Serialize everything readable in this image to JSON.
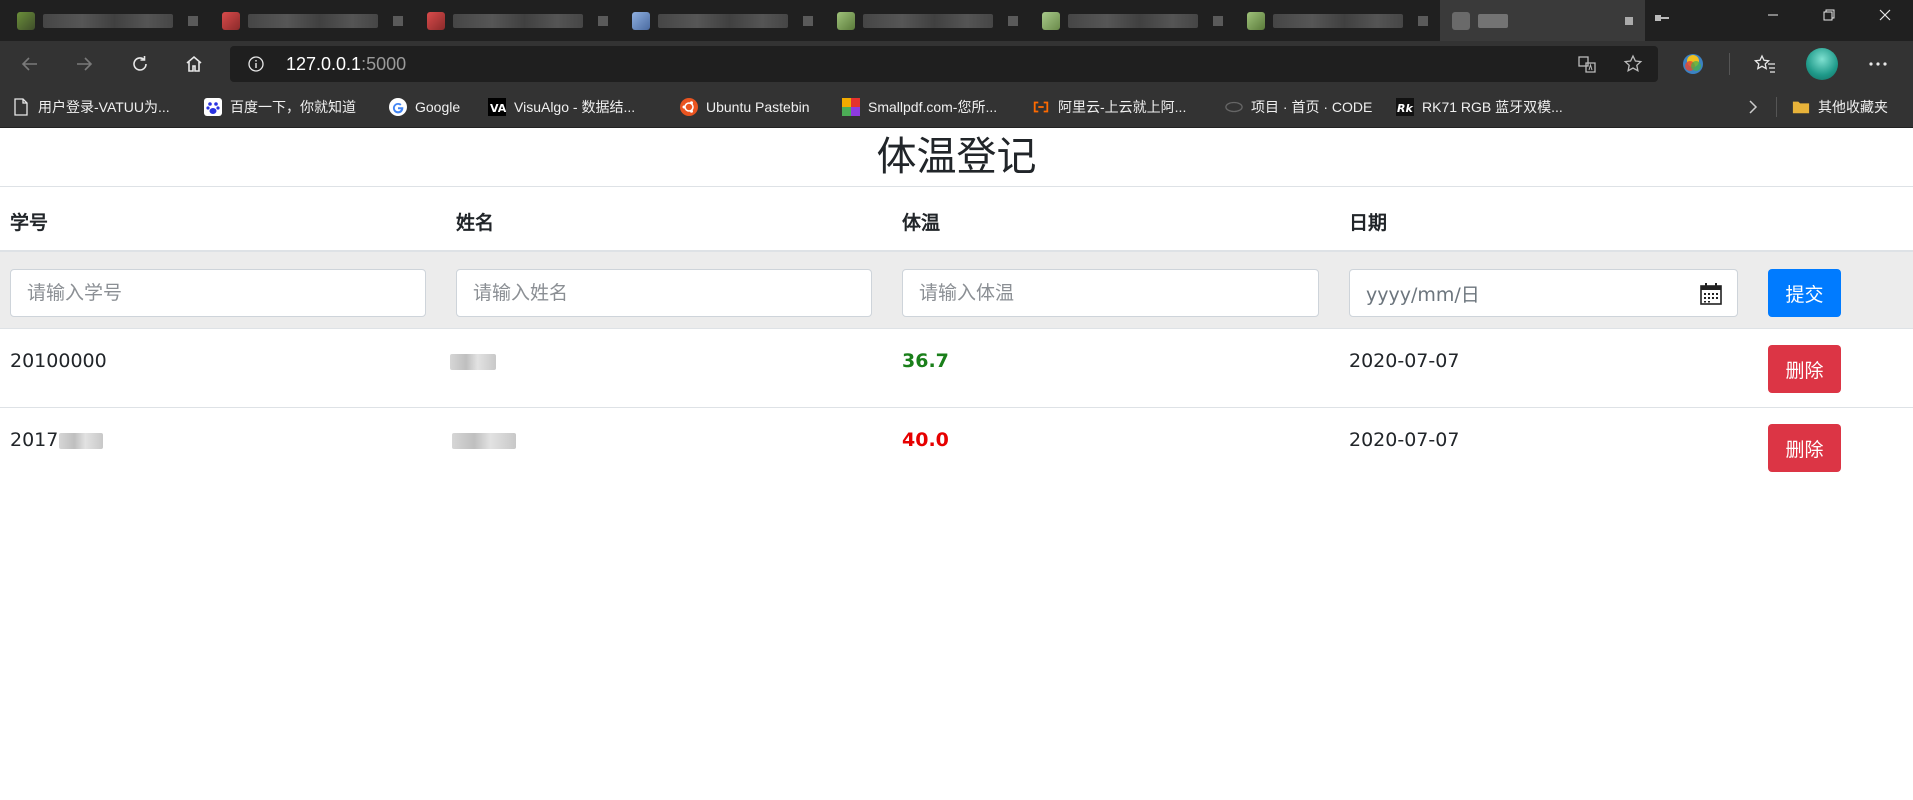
{
  "browser": {
    "url_host": "127.0.0.1",
    "url_port": ":5000",
    "bookmarks": [
      {
        "label": "用户登录-VATUU为...",
        "icon": "page-icon"
      },
      {
        "label": "百度一下，你就知道",
        "icon": "baidu-icon"
      },
      {
        "label": "Google",
        "icon": "google-icon"
      },
      {
        "label": "VisuAlgo - 数据结...",
        "icon": "visualgo-icon"
      },
      {
        "label": "Ubuntu Pastebin",
        "icon": "ubuntu-icon"
      },
      {
        "label": "Smallpdf.com-您所...",
        "icon": "smallpdf-icon"
      },
      {
        "label": "阿里云-上云就上阿...",
        "icon": "aliyun-icon"
      },
      {
        "label": "项目 · 首页 · CODE",
        "icon": "code-icon"
      },
      {
        "label": "RK71 RGB 蓝牙双模...",
        "icon": "rk-icon"
      }
    ],
    "other_bookmarks": "其他收藏夹",
    "colors": {
      "tabbar": "#202020",
      "toolbar": "#333333",
      "address_bar": "#1f1f1f"
    }
  },
  "page": {
    "title": "体温登记",
    "headers": {
      "id": "学号",
      "name": "姓名",
      "temp": "体温",
      "date": "日期"
    },
    "form": {
      "id_placeholder": "请输入学号",
      "name_placeholder": "请输入姓名",
      "temp_placeholder": "请输入体温",
      "date_placeholder": "yyyy/mm/日",
      "submit_label": "提交"
    },
    "rows": [
      {
        "id": "20100000",
        "name": "",
        "temp": "36.7",
        "temp_status": "normal",
        "date": "2020-07-07",
        "delete_label": "删除"
      },
      {
        "id": "2017",
        "name": "",
        "temp": "40.0",
        "temp_status": "high",
        "date": "2020-07-07",
        "delete_label": "删除"
      }
    ],
    "colors": {
      "primary": "#007bff",
      "danger": "#dc3545",
      "temp_normal": "#1a7f1a",
      "temp_high": "#e60000"
    }
  }
}
